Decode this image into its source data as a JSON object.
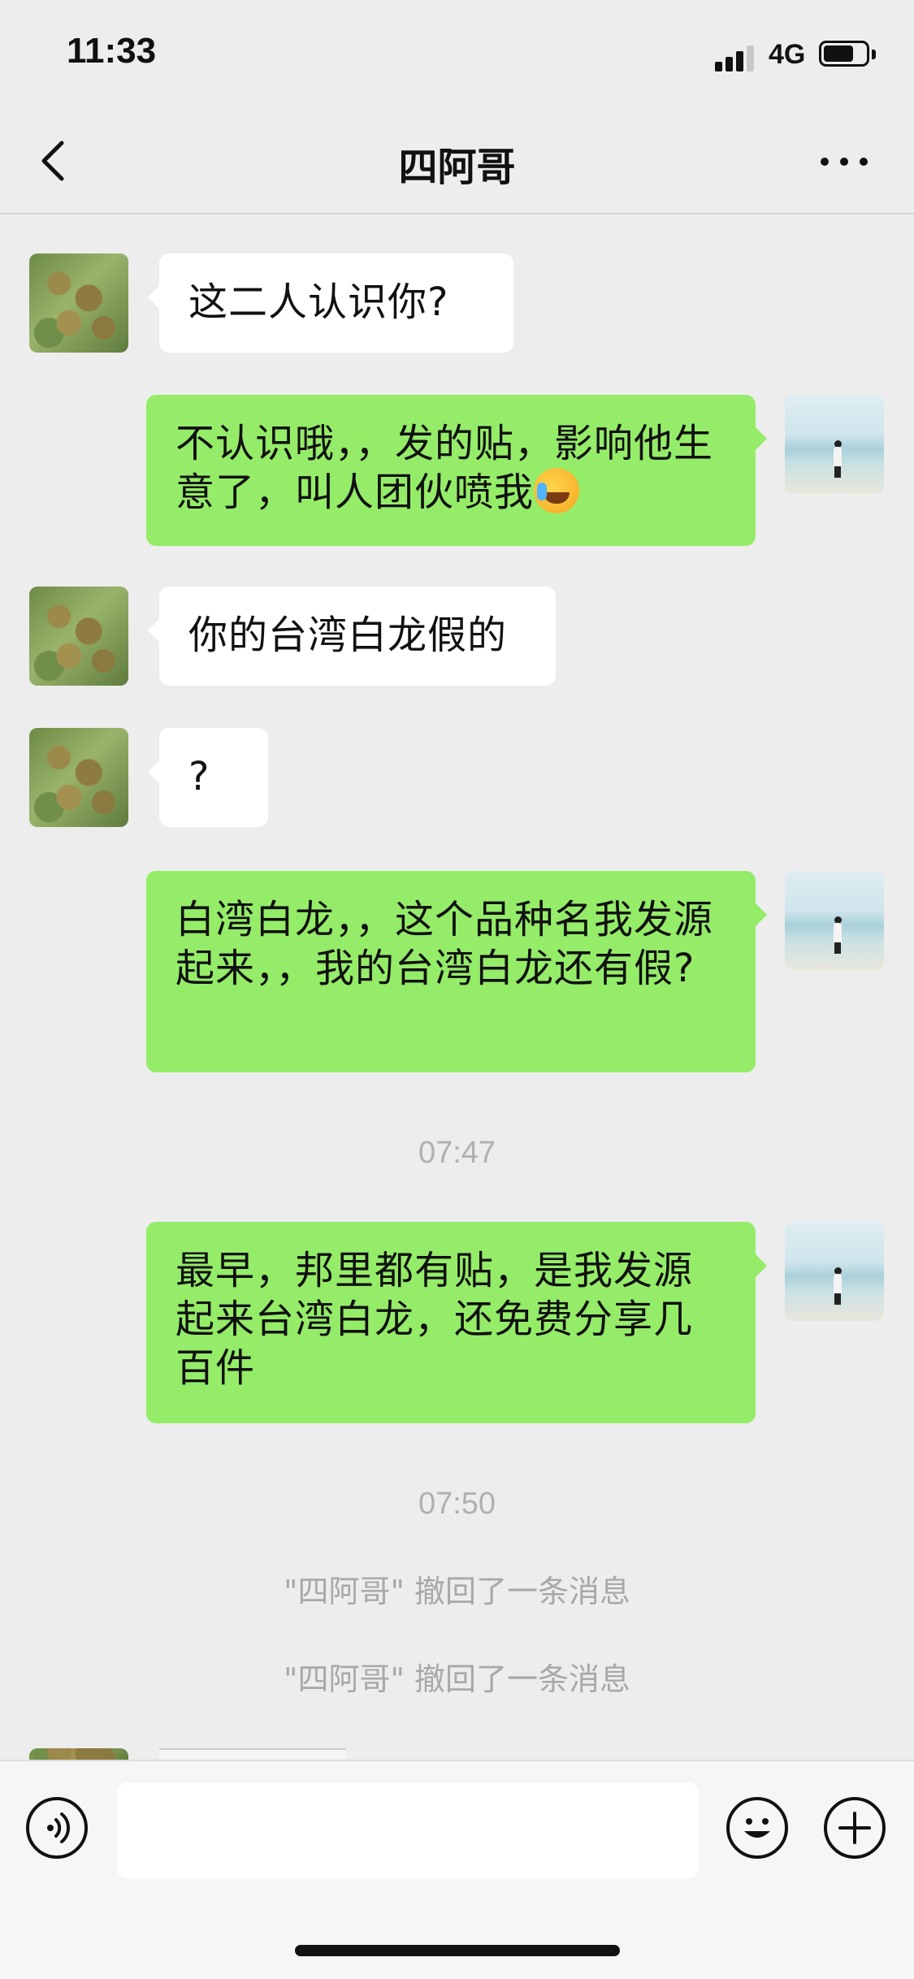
{
  "status_bar": {
    "time": "11:33",
    "network": "4G",
    "signal_bars": 3,
    "battery_level": 0.6
  },
  "nav": {
    "title": "四阿哥",
    "back_icon": "chevron-left-icon",
    "more_icon": "more-dots-icon"
  },
  "messages": [
    {
      "side": "in",
      "text": "这二人认识你?"
    },
    {
      "side": "out",
      "text": "不认识哦，，发的贴，影响他生意了，叫人团伙喷我",
      "emoji": "laughing-crying-emoji"
    },
    {
      "side": "in",
      "text": "你的台湾白龙假的"
    },
    {
      "side": "in",
      "text": "?"
    },
    {
      "side": "out",
      "text": "白湾白龙，，这个品种名我发源起来，，我的台湾白龙还有假?"
    },
    {
      "side": "out",
      "text": "最早，邦里都有贴，是我发源起来台湾白龙，还免费分享几百件"
    }
  ],
  "timestamps": [
    "07:47",
    "07:50"
  ],
  "system_messages": [
    "\"四阿哥\" 撤回了一条消息",
    "\"四阿哥\" 撤回了一条消息"
  ],
  "input_bar": {
    "voice_icon": "voice-icon",
    "emoji_icon": "emoji-icon",
    "plus_icon": "plus-icon",
    "input_value": ""
  },
  "colors": {
    "background": "#ededed",
    "bubble_out": "#95ec69",
    "bubble_in": "#ffffff"
  }
}
